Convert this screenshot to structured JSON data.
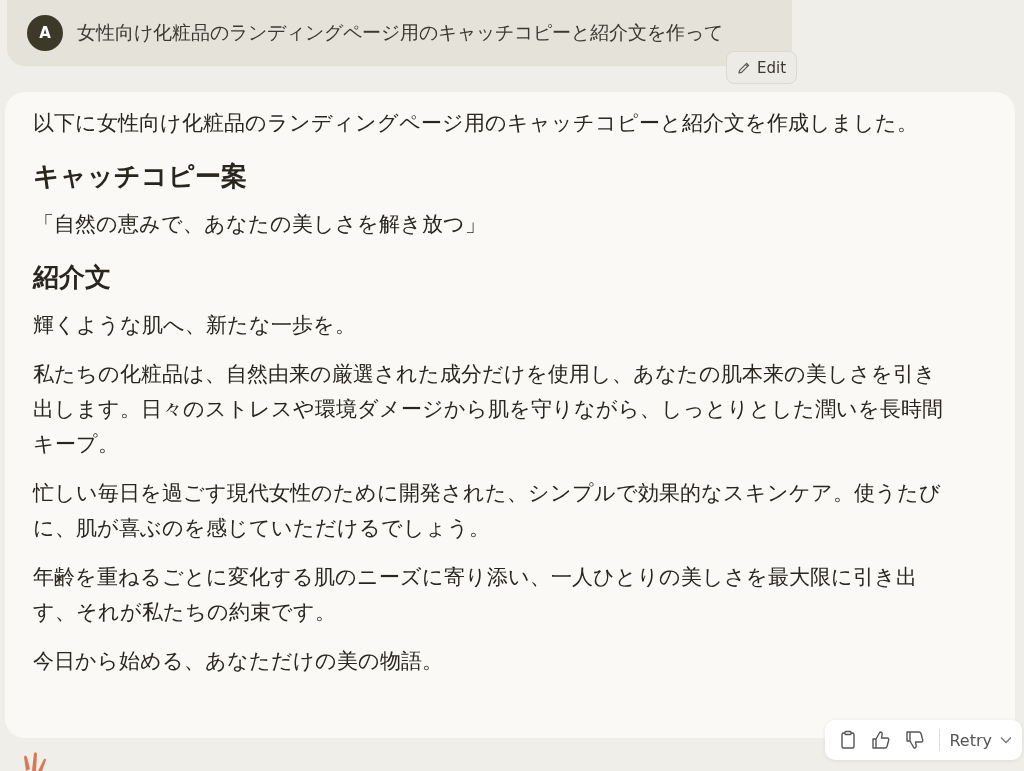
{
  "user_message": {
    "avatar": "A",
    "text": "女性向け化粧品のランディングページ用のキャッチコピーと紹介文を作って",
    "edit_label": "Edit"
  },
  "response": {
    "blocks": [
      {
        "kind": "paragraph",
        "text": "以下に女性向け化粧品のランディングページ用のキャッチコピーと紹介文を作成しました。"
      },
      {
        "kind": "heading",
        "text": "キャッチコピー案"
      },
      {
        "kind": "paragraph",
        "text": "「自然の恵みで、あなたの美しさを解き放つ」"
      },
      {
        "kind": "heading",
        "text": "紹介文"
      },
      {
        "kind": "paragraph",
        "text": "輝くような肌へ、新たな一歩を。"
      },
      {
        "kind": "paragraph",
        "text": "私たちの化粧品は、自然由来の厳選された成分だけを使用し、あなたの肌本来の美しさを引き出します。日々のストレスや環境ダメージから肌を守りながら、しっとりとした潤いを長時間キープ。"
      },
      {
        "kind": "paragraph",
        "text": "忙しい毎日を過ごす現代女性のために開発された、シンプルで効果的なスキンケア。使うたびに、肌が喜ぶのを感じていただけるでしょう。"
      },
      {
        "kind": "paragraph",
        "text": "年齢を重ねるごとに変化する肌のニーズに寄り添い、一人ひとりの美しさを最大限に引き出す、それが私たちの約束です。"
      },
      {
        "kind": "paragraph",
        "text": "今日から始める、あなただけの美の物語。"
      }
    ]
  },
  "actions": {
    "retry_label": "Retry"
  }
}
